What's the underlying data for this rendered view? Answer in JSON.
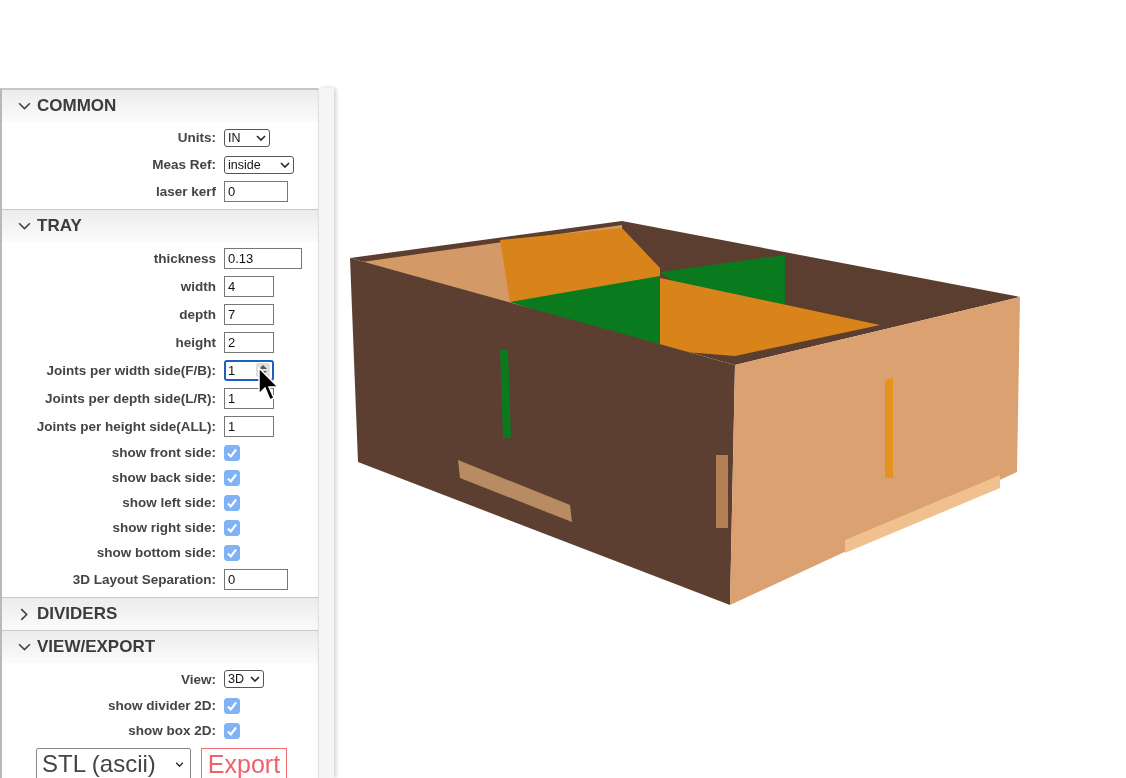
{
  "sections": [
    {
      "title": "COMMON",
      "expanded": true,
      "rows": [
        {
          "kind": "select",
          "label": "Units:",
          "value": "IN"
        },
        {
          "kind": "select",
          "label": "Meas Ref:",
          "value": "inside"
        },
        {
          "kind": "text",
          "label": "laser kerf",
          "value": "0"
        }
      ]
    },
    {
      "title": "TRAY",
      "expanded": true,
      "rows": [
        {
          "kind": "text",
          "label": "thickness",
          "value": "0.13"
        },
        {
          "kind": "text",
          "label": "width",
          "value": "4"
        },
        {
          "kind": "text",
          "label": "depth",
          "value": "7"
        },
        {
          "kind": "text",
          "label": "height",
          "value": "2"
        },
        {
          "kind": "number",
          "label": "Joints per width side(F/B):",
          "value": "1",
          "focused": true
        },
        {
          "kind": "number",
          "label": "Joints per depth side(L/R):",
          "value": "1",
          "focused": false
        },
        {
          "kind": "number",
          "label": "Joints per height side(ALL):",
          "value": "1",
          "focused": false
        },
        {
          "kind": "checkbox",
          "label": "show front side:",
          "checked": true
        },
        {
          "kind": "checkbox",
          "label": "show back side:",
          "checked": true
        },
        {
          "kind": "checkbox",
          "label": "show left side:",
          "checked": true
        },
        {
          "kind": "checkbox",
          "label": "show right side:",
          "checked": true
        },
        {
          "kind": "checkbox",
          "label": "show bottom side:",
          "checked": true
        },
        {
          "kind": "text",
          "label": "3D Layout Separation:",
          "value": "0"
        }
      ]
    },
    {
      "title": "DIVIDERS",
      "expanded": false
    },
    {
      "title": "VIEW/EXPORT",
      "expanded": true,
      "rows": [
        {
          "kind": "select",
          "label": "View:",
          "value": "3D"
        },
        {
          "kind": "checkbox",
          "label": "show divider 2D:",
          "checked": true
        },
        {
          "kind": "checkbox",
          "label": "show box 2D:",
          "checked": true
        },
        {
          "kind": "export",
          "value": "STL (ascii)",
          "button": "Export"
        }
      ]
    }
  ]
}
